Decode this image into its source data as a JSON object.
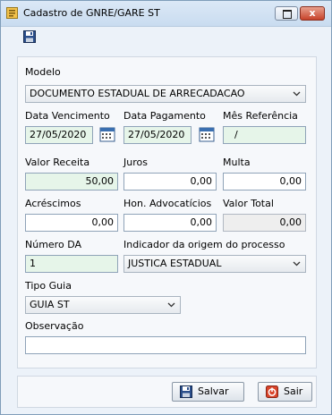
{
  "window": {
    "title": "Cadastro de GNRE/GARE ST",
    "close_glyph": "x",
    "icons": {
      "app": "app-icon",
      "restore": "restore-icon",
      "close": "close-icon",
      "save_toolbar": "save-icon"
    }
  },
  "form": {
    "modelo": {
      "label": "Modelo",
      "value": "DOCUMENTO ESTADUAL DE ARRECADACAO"
    },
    "data_vencimento": {
      "label": "Data Vencimento",
      "value": "27/05/2020"
    },
    "data_pagamento": {
      "label": "Data Pagamento",
      "value": "27/05/2020"
    },
    "mes_referencia": {
      "label": "Mês Referência",
      "value": "/"
    },
    "valor_receita": {
      "label": "Valor Receita",
      "value": "50,00"
    },
    "juros": {
      "label": "Juros",
      "value": "0,00"
    },
    "multa": {
      "label": "Multa",
      "value": "0,00"
    },
    "acrescimos": {
      "label": "Acréscimos",
      "value": "0,00"
    },
    "hon_advocaticios": {
      "label": "Hon. Advocatícios",
      "value": "0,00"
    },
    "valor_total": {
      "label": "Valor Total",
      "value": "0,00"
    },
    "numero_da": {
      "label": "Número DA",
      "value": "1"
    },
    "indicador_origem": {
      "label": "Indicador da origem do processo",
      "value": "JUSTICA ESTADUAL"
    },
    "tipo_guia": {
      "label": "Tipo Guia",
      "value": "GUIA ST"
    },
    "observacao": {
      "label": "Observação",
      "value": ""
    }
  },
  "buttons": {
    "salvar": "Salvar",
    "sair": "Sair"
  },
  "colors": {
    "required_field_bg": "#e6f5e9",
    "readonly_field_bg": "#eeeeee",
    "close_button": "#c7432a"
  }
}
